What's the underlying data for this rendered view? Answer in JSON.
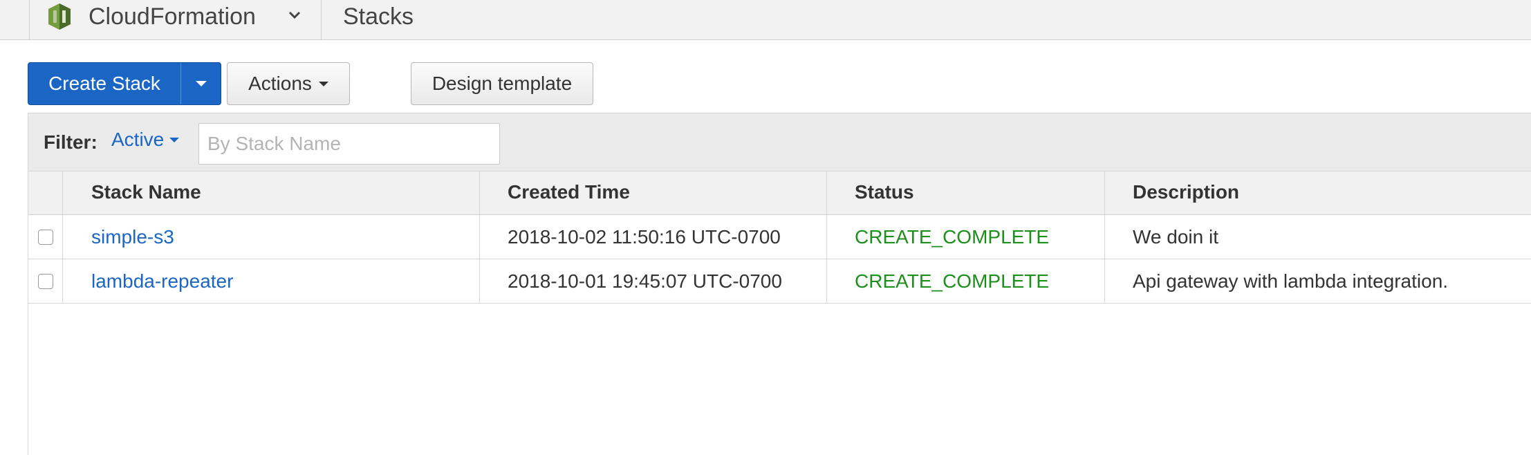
{
  "header": {
    "service_name": "CloudFormation",
    "page_title": "Stacks"
  },
  "toolbar": {
    "create_label": "Create Stack",
    "actions_label": "Actions",
    "design_label": "Design template"
  },
  "filter": {
    "label": "Filter:",
    "status_value": "Active",
    "placeholder": "By Stack Name"
  },
  "table": {
    "columns": [
      "Stack Name",
      "Created Time",
      "Status",
      "Description"
    ],
    "rows": [
      {
        "name": "simple-s3",
        "created": "2018-10-02 11:50:16 UTC-0700",
        "status": "CREATE_COMPLETE",
        "description": "We doin it"
      },
      {
        "name": "lambda-repeater",
        "created": "2018-10-01 19:45:07 UTC-0700",
        "status": "CREATE_COMPLETE",
        "description": "Api gateway with lambda integration."
      }
    ]
  },
  "colors": {
    "primary_button": "#1b66c4",
    "link": "#1b66c4",
    "status_complete": "#1d8f1d"
  },
  "icons": [
    "cloudformation-logo-icon",
    "chevron-down-icon",
    "caret-down-icon"
  ]
}
